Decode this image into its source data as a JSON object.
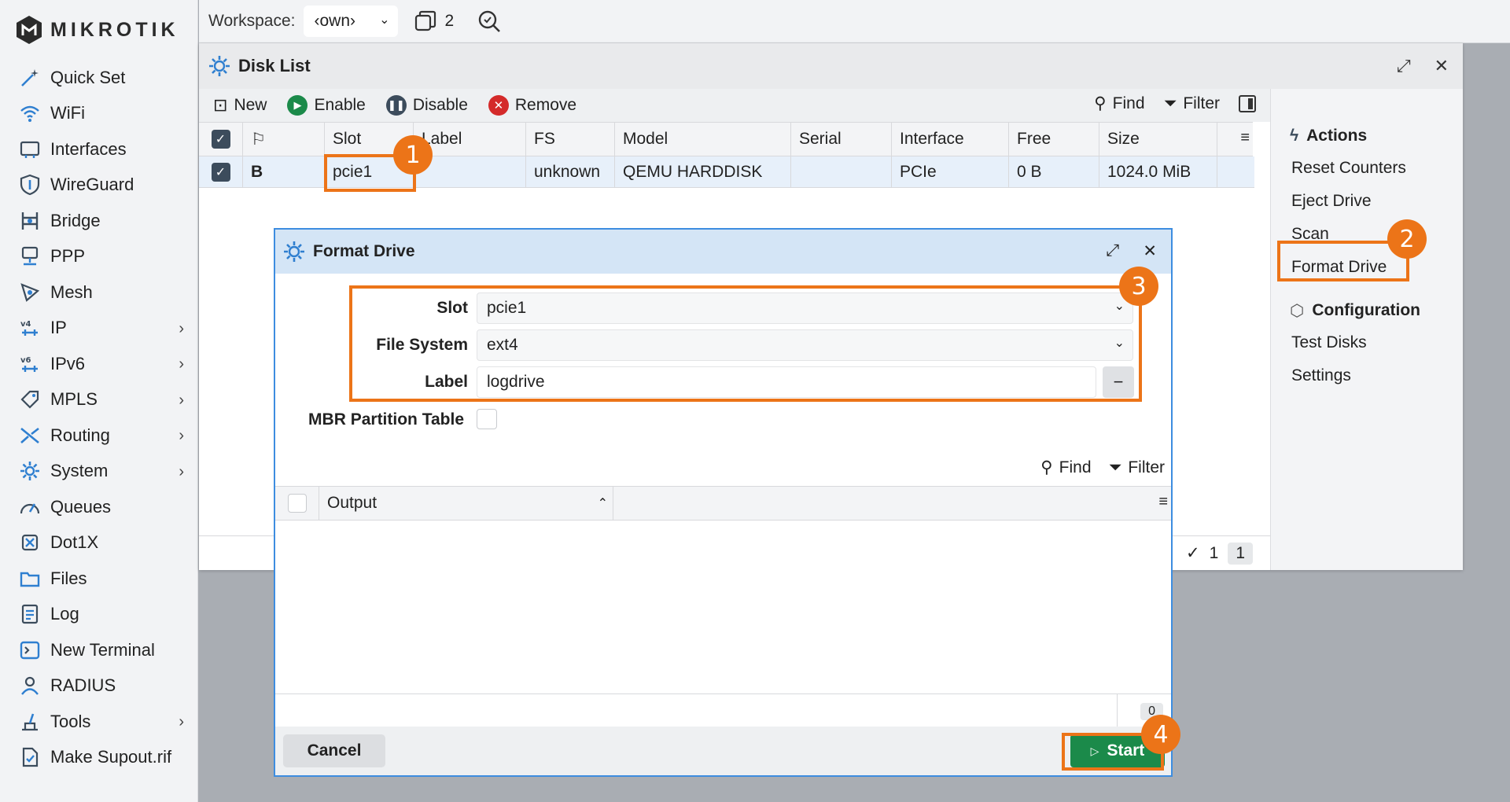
{
  "brand": "MikroTik",
  "sidebar": {
    "items": [
      {
        "label": "Quick Set",
        "icon": "wand-icon",
        "chevron": ""
      },
      {
        "label": "WiFi",
        "icon": "wifi-icon",
        "chevron": ""
      },
      {
        "label": "Interfaces",
        "icon": "interfaces-icon",
        "chevron": ""
      },
      {
        "label": "WireGuard",
        "icon": "shield-icon",
        "chevron": ""
      },
      {
        "label": "Bridge",
        "icon": "bridge-icon",
        "chevron": ""
      },
      {
        "label": "PPP",
        "icon": "ppp-icon",
        "chevron": ""
      },
      {
        "label": "Mesh",
        "icon": "mesh-icon",
        "chevron": ""
      },
      {
        "label": "IP",
        "icon": "ip-icon",
        "chevron": "›"
      },
      {
        "label": "IPv6",
        "icon": "ipv6-icon",
        "chevron": "›"
      },
      {
        "label": "MPLS",
        "icon": "tag-icon",
        "chevron": "›"
      },
      {
        "label": "Routing",
        "icon": "routing-icon",
        "chevron": "›"
      },
      {
        "label": "System",
        "icon": "gear-icon",
        "chevron": "›"
      },
      {
        "label": "Queues",
        "icon": "gauge-icon",
        "chevron": ""
      },
      {
        "label": "Dot1X",
        "icon": "dot1x-icon",
        "chevron": ""
      },
      {
        "label": "Files",
        "icon": "folder-icon",
        "chevron": ""
      },
      {
        "label": "Log",
        "icon": "log-icon",
        "chevron": ""
      },
      {
        "label": "New Terminal",
        "icon": "terminal-icon",
        "chevron": ""
      },
      {
        "label": "RADIUS",
        "icon": "radius-icon",
        "chevron": ""
      },
      {
        "label": "Tools",
        "icon": "tools-icon",
        "chevron": "›"
      },
      {
        "label": "Make Supout.rif",
        "icon": "file-icon",
        "chevron": ""
      }
    ]
  },
  "topbar": {
    "workspace_label": "Workspace:",
    "workspace_value": "‹own›",
    "window_count": "2"
  },
  "disk_list": {
    "title": "Disk List",
    "toolbar": {
      "new": "New",
      "enable": "Enable",
      "disable": "Disable",
      "remove": "Remove",
      "find": "Find",
      "filter": "Filter"
    },
    "columns": [
      "Slot",
      "Label",
      "FS",
      "Model",
      "Serial",
      "Interface",
      "Free",
      "Size"
    ],
    "rows": [
      {
        "flag": "B",
        "slot": "pcie1",
        "label": "",
        "fs": "unknown",
        "model": "QEMU HARDDISK",
        "serial": "",
        "interface": "PCIe",
        "free": "0 B",
        "size": "1024.0 MiB"
      }
    ],
    "status": {
      "selected": "1",
      "total": "1"
    }
  },
  "actions_panel": {
    "actions_heading": "Actions",
    "actions": [
      "Reset Counters",
      "Eject Drive",
      "Scan",
      "Format Drive"
    ],
    "config_heading": "Configuration",
    "config": [
      "Test Disks",
      "Settings"
    ]
  },
  "format_drive": {
    "title": "Format Drive",
    "slot_label": "Slot",
    "slot_value": "pcie1",
    "fs_label": "File System",
    "fs_value": "ext4",
    "label_label": "Label",
    "label_value": "logdrive",
    "mbr_label": "MBR Partition Table",
    "find": "Find",
    "filter": "Filter",
    "output_header": "Output",
    "output_count": "0",
    "cancel": "Cancel",
    "start": "Start"
  },
  "annotations": [
    "1",
    "2",
    "3",
    "4"
  ],
  "colors": {
    "accent": "#ec7418",
    "start_green": "#1b8a4a",
    "selection": "#e7f0fa",
    "dialog_border": "#3d8de0"
  }
}
